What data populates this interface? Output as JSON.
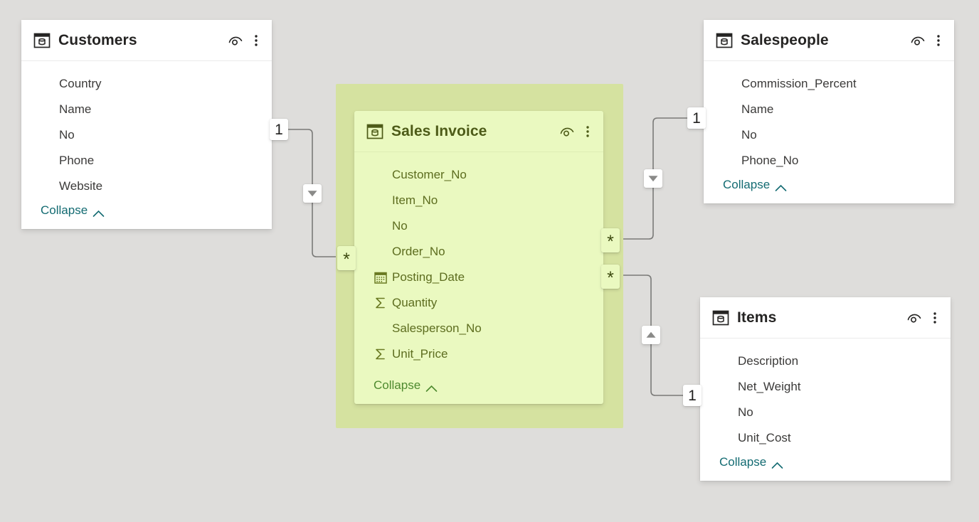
{
  "canvas": {
    "background_color": "#dedddb",
    "selection_highlight_color": "#d5e2a0",
    "selected_card_color": "#eaf9c0",
    "relationship_line_color": "#7a7a78",
    "collapse_link_color": "#136b72"
  },
  "tables": [
    {
      "id": "customers",
      "name": "Customers",
      "selected": false,
      "table_icon": "table-icon",
      "eye_icon": "eye-icon",
      "kebab_icon": "more-options-icon",
      "collapse_label": "Collapse",
      "fields": [
        {
          "name": "Country",
          "icon": "none"
        },
        {
          "name": "Name",
          "icon": "none"
        },
        {
          "name": "No",
          "icon": "none"
        },
        {
          "name": "Phone",
          "icon": "none"
        },
        {
          "name": "Website",
          "icon": "none"
        }
      ]
    },
    {
      "id": "sales-invoice",
      "name": "Sales Invoice",
      "selected": true,
      "table_icon": "table-icon",
      "eye_icon": "eye-icon",
      "kebab_icon": "more-options-icon",
      "collapse_label": "Collapse",
      "fields": [
        {
          "name": "Customer_No",
          "icon": "none"
        },
        {
          "name": "Item_No",
          "icon": "none"
        },
        {
          "name": "No",
          "icon": "none"
        },
        {
          "name": "Order_No",
          "icon": "none"
        },
        {
          "name": "Posting_Date",
          "icon": "calendar-icon"
        },
        {
          "name": "Quantity",
          "icon": "sum-icon"
        },
        {
          "name": "Salesperson_No",
          "icon": "none"
        },
        {
          "name": "Unit_Price",
          "icon": "sum-icon"
        }
      ]
    },
    {
      "id": "salespeople",
      "name": "Salespeople",
      "selected": false,
      "table_icon": "table-icon",
      "eye_icon": "eye-icon",
      "kebab_icon": "more-options-icon",
      "collapse_label": "Collapse",
      "fields": [
        {
          "name": "Commission_Percent",
          "icon": "none"
        },
        {
          "name": "Name",
          "icon": "none"
        },
        {
          "name": "No",
          "icon": "none"
        },
        {
          "name": "Phone_No",
          "icon": "none"
        }
      ]
    },
    {
      "id": "items",
      "name": "Items",
      "selected": false,
      "table_icon": "table-icon",
      "eye_icon": "eye-icon",
      "kebab_icon": "more-options-icon",
      "collapse_label": "Collapse",
      "fields": [
        {
          "name": "Description",
          "icon": "none"
        },
        {
          "name": "Net_Weight",
          "icon": "none"
        },
        {
          "name": "No",
          "icon": "none"
        },
        {
          "name": "Unit_Cost",
          "icon": "none"
        }
      ]
    }
  ],
  "relationships": [
    {
      "id": "customers-sales-invoice",
      "from_table": "Customers",
      "to_table": "Sales Invoice",
      "from_cardinality": "1",
      "to_cardinality": "*",
      "filter_direction_icon": "arrow-down-icon"
    },
    {
      "id": "salespeople-sales-invoice",
      "from_table": "Salespeople",
      "to_table": "Sales Invoice",
      "from_cardinality": "1",
      "to_cardinality": "*",
      "filter_direction_icon": "arrow-down-icon"
    },
    {
      "id": "items-sales-invoice",
      "from_table": "Items",
      "to_table": "Sales Invoice",
      "from_cardinality": "1",
      "to_cardinality": "*",
      "filter_direction_icon": "arrow-up-icon"
    }
  ]
}
